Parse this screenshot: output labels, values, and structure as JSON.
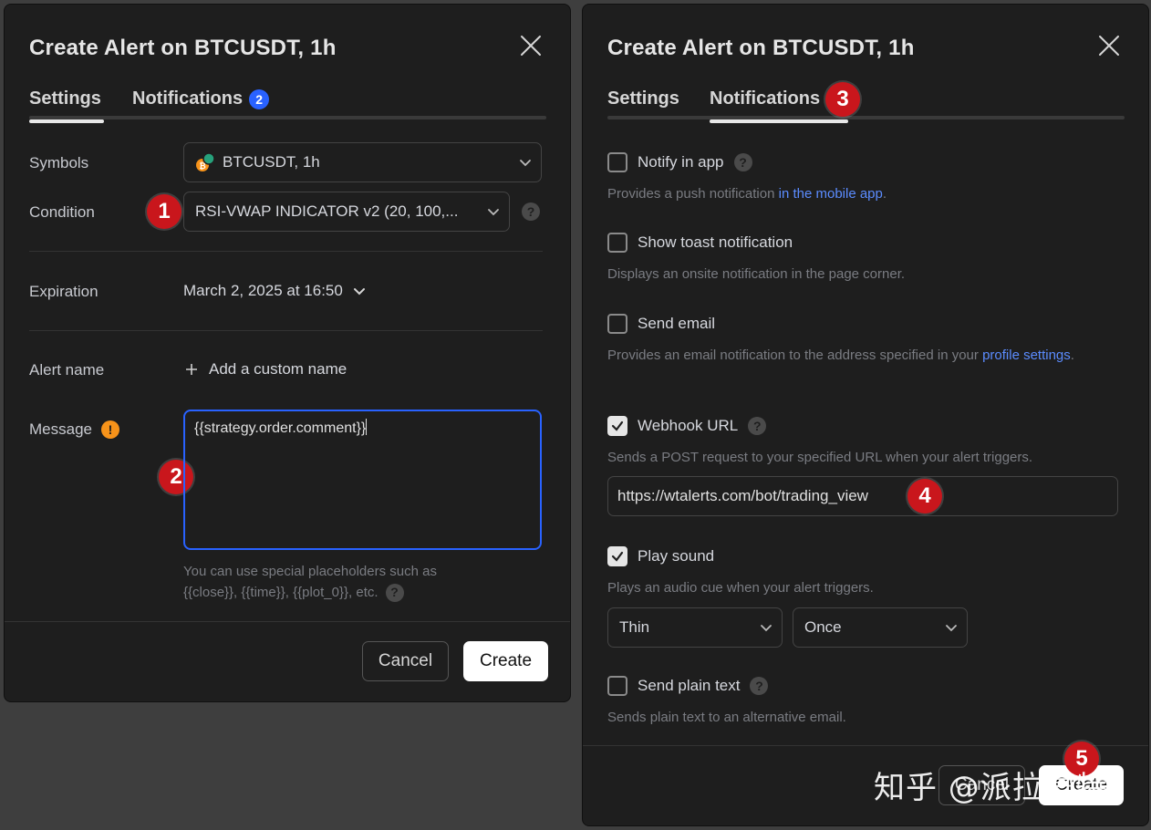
{
  "left_dialog": {
    "title": "Create Alert on BTCUSDT, 1h",
    "tabs": [
      {
        "label": "Settings",
        "active": true
      },
      {
        "label": "Notifications",
        "badge": "2",
        "active": false
      }
    ],
    "symbols": {
      "label": "Symbols",
      "value": "BTCUSDT, 1h"
    },
    "condition": {
      "label": "Condition",
      "value": "RSI-VWAP INDICATOR v2 (20, 100,..."
    },
    "expiration": {
      "label": "Expiration",
      "value": "March 2, 2025 at 16:50"
    },
    "alert_name": {
      "label": "Alert name",
      "action": "Add a custom name"
    },
    "message": {
      "label": "Message",
      "value": "{{strategy.order.comment}}",
      "hint_line1": "You can use special placeholders such as",
      "hint_line2": "{{close}}, {{time}}, {{plot_0}}, etc."
    },
    "buttons": {
      "cancel": "Cancel",
      "create": "Create"
    }
  },
  "right_dialog": {
    "title": "Create Alert on BTCUSDT, 1h",
    "tabs": [
      {
        "label": "Settings",
        "active": false
      },
      {
        "label": "Notifications",
        "active": true
      }
    ],
    "options": {
      "notify_app": {
        "label": "Notify in app",
        "checked": false,
        "desc_prefix": "Provides a push notification ",
        "desc_link": "in the mobile app",
        "desc_suffix": "."
      },
      "toast": {
        "label": "Show toast notification",
        "checked": false,
        "desc": "Displays an onsite notification in the page corner."
      },
      "email": {
        "label": "Send email",
        "checked": false,
        "desc_prefix": "Provides an email notification to the address specified in your ",
        "desc_link": "profile settings",
        "desc_suffix": "."
      },
      "webhook": {
        "label": "Webhook URL",
        "checked": true,
        "desc": "Sends a POST request to your specified URL when your alert triggers.",
        "url": "https://wtalerts.com/bot/trading_view"
      },
      "sound": {
        "label": "Play sound",
        "checked": true,
        "desc": "Plays an audio cue when your alert triggers.",
        "sound_type": "Thin",
        "sound_repeat": "Once"
      },
      "plain_text": {
        "label": "Send plain text",
        "checked": false,
        "desc": "Sends plain text to an alternative email."
      }
    },
    "buttons": {
      "cancel": "Cancel",
      "create": "Create"
    }
  },
  "annotations": [
    "1",
    "2",
    "3",
    "4",
    "5"
  ],
  "watermark": "知乎 @派拉蒙特",
  "colors": {
    "accent": "#2962ff",
    "marker": "#c9161c",
    "warning": "#f7931a",
    "link": "#5b8cff"
  }
}
